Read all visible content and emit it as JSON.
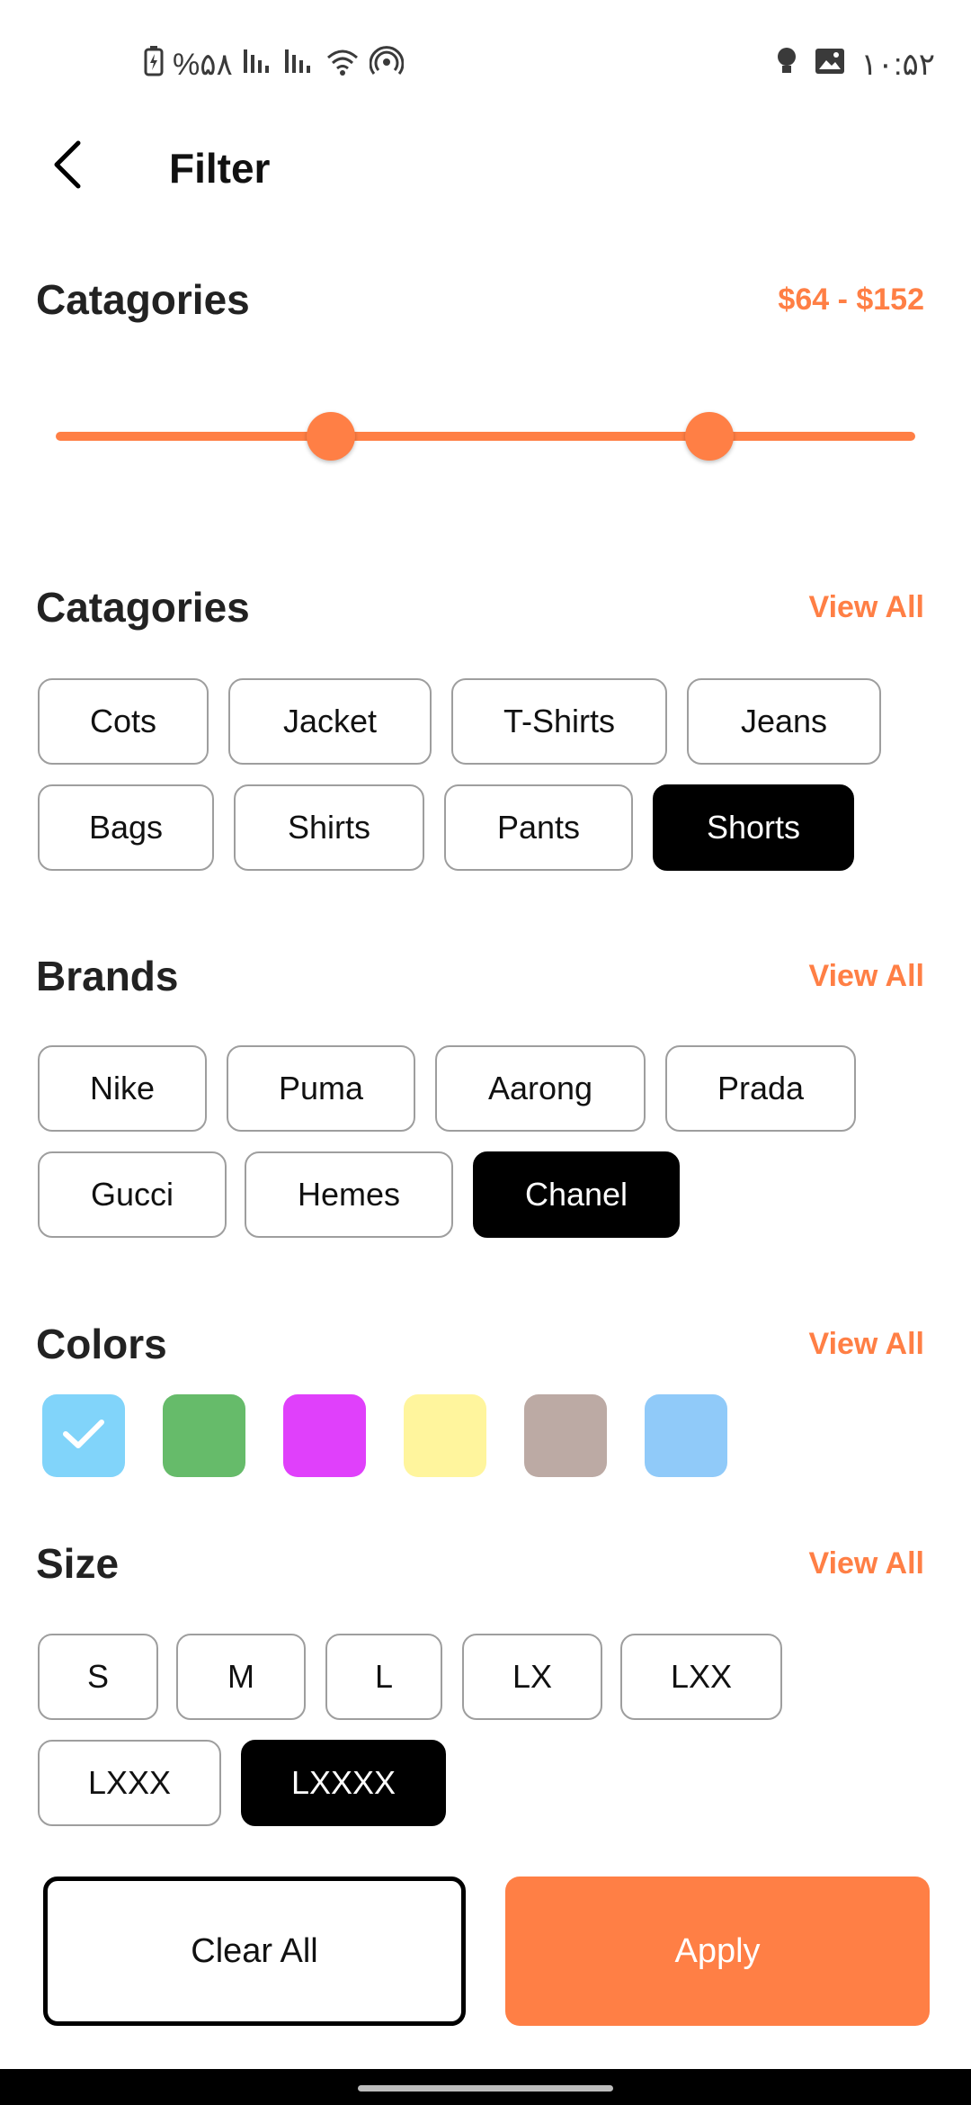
{
  "status_bar": {
    "battery": "%۵۸",
    "time": "۱۰:۵۲"
  },
  "header": {
    "title": "Filter"
  },
  "price": {
    "title": "Catagories",
    "range_label": "$64 - $152",
    "slider_low_fraction": 0.32,
    "slider_high_fraction": 0.76
  },
  "categories": {
    "title": "Catagories",
    "view_all": "View All",
    "items": [
      {
        "label": "Cots",
        "selected": false
      },
      {
        "label": "Jacket",
        "selected": false
      },
      {
        "label": "T-Shirts",
        "selected": false
      },
      {
        "label": "Jeans",
        "selected": false
      },
      {
        "label": "Bags",
        "selected": false
      },
      {
        "label": "Shirts",
        "selected": false
      },
      {
        "label": "Pants",
        "selected": false
      },
      {
        "label": "Shorts",
        "selected": true
      }
    ]
  },
  "brands": {
    "title": "Brands",
    "view_all": "View All",
    "items": [
      {
        "label": "Nike",
        "selected": false
      },
      {
        "label": "Puma",
        "selected": false
      },
      {
        "label": "Aarong",
        "selected": false
      },
      {
        "label": "Prada",
        "selected": false
      },
      {
        "label": "Gucci",
        "selected": false
      },
      {
        "label": "Hemes",
        "selected": false
      },
      {
        "label": "Chanel",
        "selected": true
      }
    ]
  },
  "colors": {
    "title": "Colors",
    "view_all": "View All",
    "swatches": [
      {
        "color": "#81d4fa",
        "selected": true
      },
      {
        "color": "#66bb6a",
        "selected": false
      },
      {
        "color": "#e040fb",
        "selected": false
      },
      {
        "color": "#fff59d",
        "selected": false
      },
      {
        "color": "#bcaaa4",
        "selected": false
      },
      {
        "color": "#90caf9",
        "selected": false
      }
    ]
  },
  "size": {
    "title": "Size",
    "view_all": "View All",
    "items": [
      {
        "label": "S",
        "selected": false
      },
      {
        "label": "M",
        "selected": false
      },
      {
        "label": "L",
        "selected": false
      },
      {
        "label": "LX",
        "selected": false
      },
      {
        "label": "LXX",
        "selected": false
      },
      {
        "label": "LXXX",
        "selected": false
      },
      {
        "label": "LXXXX",
        "selected": true
      }
    ]
  },
  "actions": {
    "clear_label": "Clear All",
    "apply_label": "Apply"
  },
  "theme": {
    "accent": "#ff7f45",
    "selected_chip": "#000000"
  }
}
